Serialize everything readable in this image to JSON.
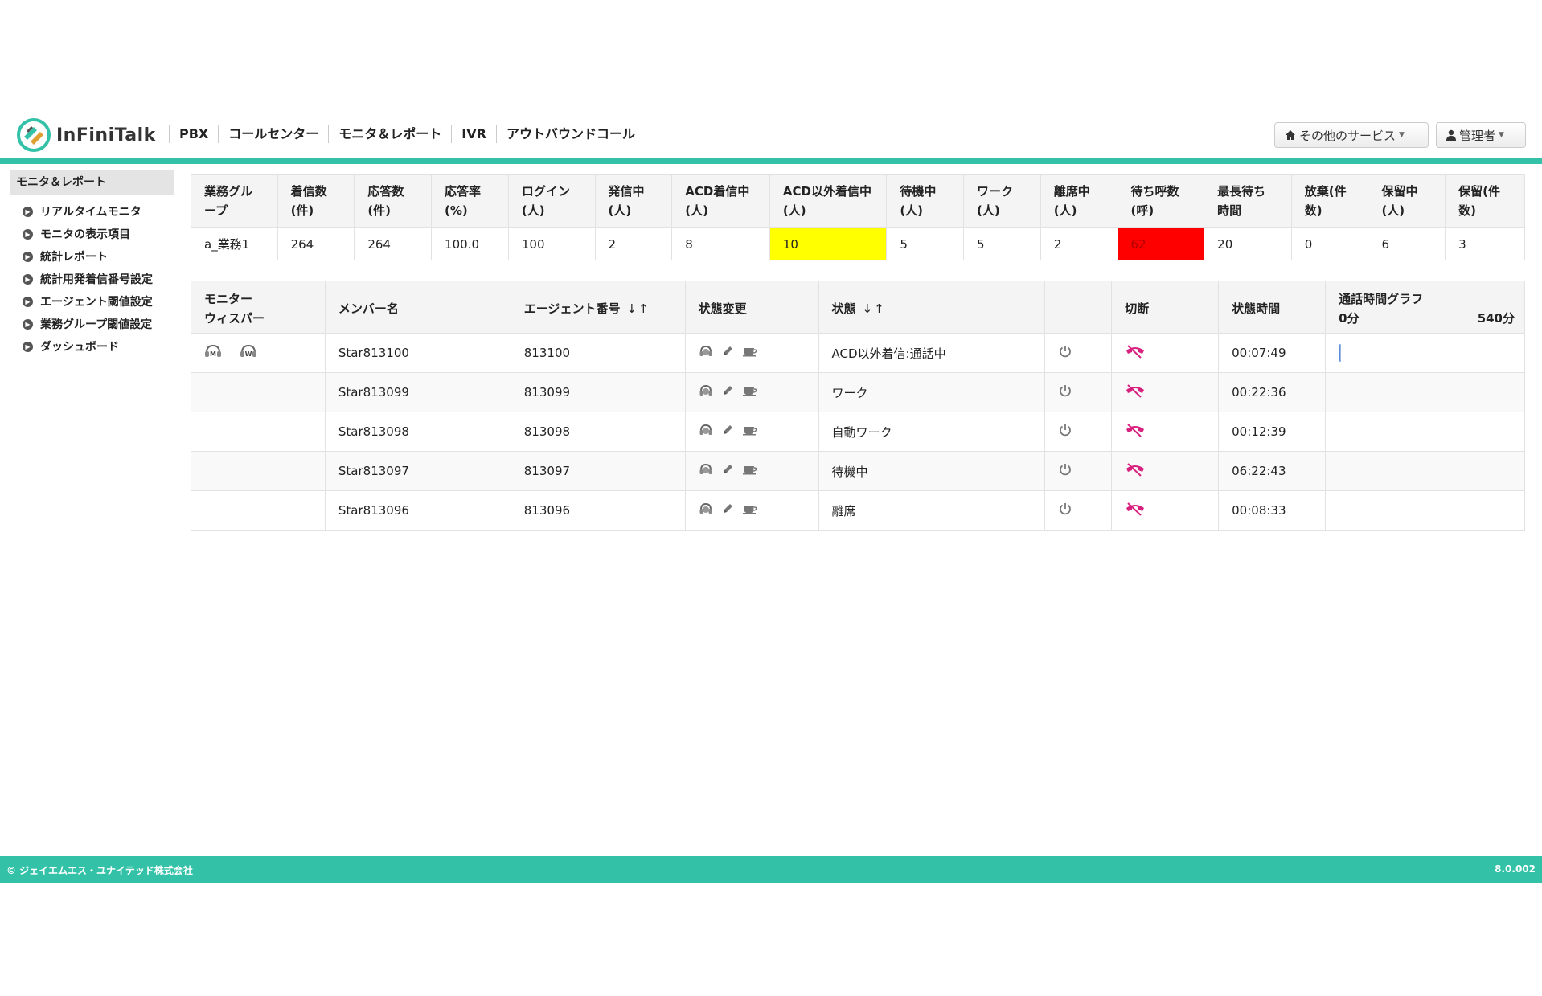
{
  "header": {
    "logo_text": "InFiniTalk",
    "nav": [
      "PBX",
      "コールセンター",
      "モニタ＆レポート",
      "IVR",
      "アウトバウンドコール"
    ],
    "other_services_label": "その他のサービス",
    "admin_label": "管理者"
  },
  "colors": {
    "accent": "#33c2a8",
    "highlight_yellow": "#ffff00",
    "highlight_red": "#ff0000",
    "hangup_icon": "#d8217f"
  },
  "sidebar": {
    "title": "モニタ＆レポート",
    "items": [
      {
        "label": "リアルタイムモニタ"
      },
      {
        "label": "モニタの表示項目"
      },
      {
        "label": "統計レポート"
      },
      {
        "label": "統計用発着信番号設定"
      },
      {
        "label": "エージェント閾値設定"
      },
      {
        "label": "業務グループ閾値設定"
      },
      {
        "label": "ダッシュボード"
      }
    ]
  },
  "summary": {
    "headers": [
      [
        "業務グル",
        "ープ"
      ],
      [
        "着信数",
        "(件)"
      ],
      [
        "応答数",
        "(件)"
      ],
      [
        "応答率",
        "(%)"
      ],
      [
        "ログイン",
        "(人)"
      ],
      [
        "発信中",
        "(人)"
      ],
      [
        "ACD着信中",
        "(人)"
      ],
      [
        "ACD以外着信中",
        "(人)"
      ],
      [
        "待機中",
        "(人)"
      ],
      [
        "ワーク",
        "(人)"
      ],
      [
        "離席中",
        "(人)"
      ],
      [
        "待ち呼数",
        "(呼)"
      ],
      [
        "最長待ち",
        "時間"
      ],
      [
        "放棄(件",
        "数)"
      ],
      [
        "保留中",
        "(人)"
      ],
      [
        "保留(件",
        "数)"
      ]
    ],
    "row": [
      "a_業務1",
      "264",
      "264",
      "100.0",
      "100",
      "2",
      "8",
      "10",
      "5",
      "5",
      "2",
      "62",
      "20",
      "0",
      "6",
      "3"
    ]
  },
  "agents": {
    "headers": {
      "monitor": [
        "モニター",
        "ウィスパー"
      ],
      "member": "メンバー名",
      "agent_no": "エージェント番号",
      "state_change": "状態変更",
      "state": "状態",
      "logout": "",
      "disconnect": "切断",
      "state_time": "状態時間",
      "graph_title": "通話時間グラフ",
      "graph_min": "0分",
      "graph_max": "540分"
    },
    "sort_arrows": "↓↑",
    "monitor_icons": [
      "M",
      "W"
    ],
    "rows": [
      {
        "member": "Star813100",
        "agent_no": "813100",
        "state": "ACD以外着信:通話中",
        "time": "00:07:49",
        "call_fraction": 0.01
      },
      {
        "member": "Star813099",
        "agent_no": "813099",
        "state": "ワーク",
        "time": "00:22:36",
        "call_fraction": 0
      },
      {
        "member": "Star813098",
        "agent_no": "813098",
        "state": "自動ワーク",
        "time": "00:12:39",
        "call_fraction": 0
      },
      {
        "member": "Star813097",
        "agent_no": "813097",
        "state": "待機中",
        "time": "06:22:43",
        "call_fraction": 0
      },
      {
        "member": "Star813096",
        "agent_no": "813096",
        "state": "離席",
        "time": "00:08:33",
        "call_fraction": 0
      }
    ]
  },
  "footer": {
    "copyright": "© ジェイエムエス・ユナイテッド株式会社",
    "version": "8.0.002"
  }
}
